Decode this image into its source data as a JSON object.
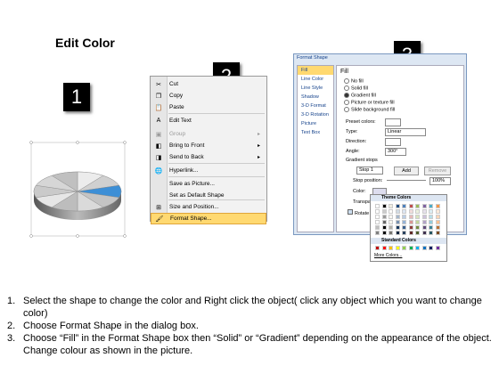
{
  "title": "Edit Color",
  "badges": [
    "1",
    "2",
    "3"
  ],
  "context_menu": {
    "items": [
      {
        "label": "Cut",
        "icon": "scissors-icon",
        "glyph": "✂",
        "disabled": false,
        "submenu": false
      },
      {
        "label": "Copy",
        "icon": "copy-icon",
        "glyph": "❐",
        "disabled": false,
        "submenu": false
      },
      {
        "label": "Paste",
        "icon": "paste-icon",
        "glyph": "📋",
        "disabled": false,
        "submenu": false
      },
      {
        "label": "Edit Text",
        "icon": "edit-text-icon",
        "glyph": "A",
        "disabled": false,
        "submenu": false
      },
      {
        "label": "Group",
        "icon": "group-icon",
        "glyph": "▣",
        "disabled": true,
        "submenu": true
      },
      {
        "label": "Bring to Front",
        "icon": "bring-front-icon",
        "glyph": "◧",
        "disabled": false,
        "submenu": true
      },
      {
        "label": "Send to Back",
        "icon": "send-back-icon",
        "glyph": "◨",
        "disabled": false,
        "submenu": true
      },
      {
        "label": "Hyperlink...",
        "icon": "hyperlink-icon",
        "glyph": "🌐",
        "disabled": false,
        "submenu": false
      },
      {
        "label": "Save as Picture...",
        "icon": "",
        "glyph": "",
        "disabled": false,
        "submenu": false
      },
      {
        "label": "Set as Default Shape",
        "icon": "",
        "glyph": "",
        "disabled": false,
        "submenu": false
      },
      {
        "label": "Size and Position...",
        "icon": "size-icon",
        "glyph": "⊞",
        "disabled": false,
        "submenu": false
      },
      {
        "label": "Format Shape...",
        "icon": "format-shape-icon",
        "glyph": "🖌",
        "disabled": false,
        "submenu": false
      }
    ]
  },
  "dialog": {
    "title": "Format Shape",
    "categories": [
      "Fill",
      "Line Color",
      "Line Style",
      "Shadow",
      "3-D Format",
      "3-D Rotation",
      "Picture",
      "Text Box"
    ],
    "selected_category": "Fill",
    "heading": "Fill",
    "fill_options": [
      "No fill",
      "Solid fill",
      "Gradient fill",
      "Picture or texture fill",
      "Slide background fill"
    ],
    "selected_fill": "Gradient fill",
    "preset_label": "Preset colors:",
    "type_label": "Type:",
    "type_value": "Linear",
    "direction_label": "Direction:",
    "angle_label": "Angle:",
    "angle_value": "300°",
    "stops_label": "Gradient stops",
    "stop_value": "Stop 1",
    "add_label": "Add",
    "remove_label": "Remove",
    "stop_position_label": "Stop position:",
    "stop_position_value": "100%",
    "color_label": "Color:",
    "transparency_label": "Transpa",
    "rotate_label": "Rotate",
    "color_popup": {
      "theme_label": "Theme Colors",
      "standard_label": "Standard Colors",
      "more_label": "More Colors...",
      "theme_colors": [
        "#ffffff",
        "#000000",
        "#eeece1",
        "#1f497d",
        "#4f81bd",
        "#c0504d",
        "#9bbb59",
        "#8064a2",
        "#4bacc6",
        "#f79646"
      ],
      "standard_colors": [
        "#c00000",
        "#ff0000",
        "#ffc000",
        "#ffff00",
        "#92d050",
        "#00b050",
        "#00b0f0",
        "#0070c0",
        "#002060",
        "#7030a0"
      ]
    }
  },
  "instructions": [
    {
      "num": "1.",
      "text": "Select the shape to change the color and Right click the object( click any object which you want to change color)"
    },
    {
      "num": "2.",
      "text": "Choose Format Shape in the dialog box."
    },
    {
      "num": "3.",
      "text": "Choose “Fill” in the Format Shape box then “Solid” or “Gradient” depending on the appearance of the object. Change colour as shown in the picture."
    }
  ],
  "colors": {
    "highlight": "#ffd971",
    "pie_selected": "#3d8fd6",
    "dialog_bg": "#dde7f3"
  }
}
